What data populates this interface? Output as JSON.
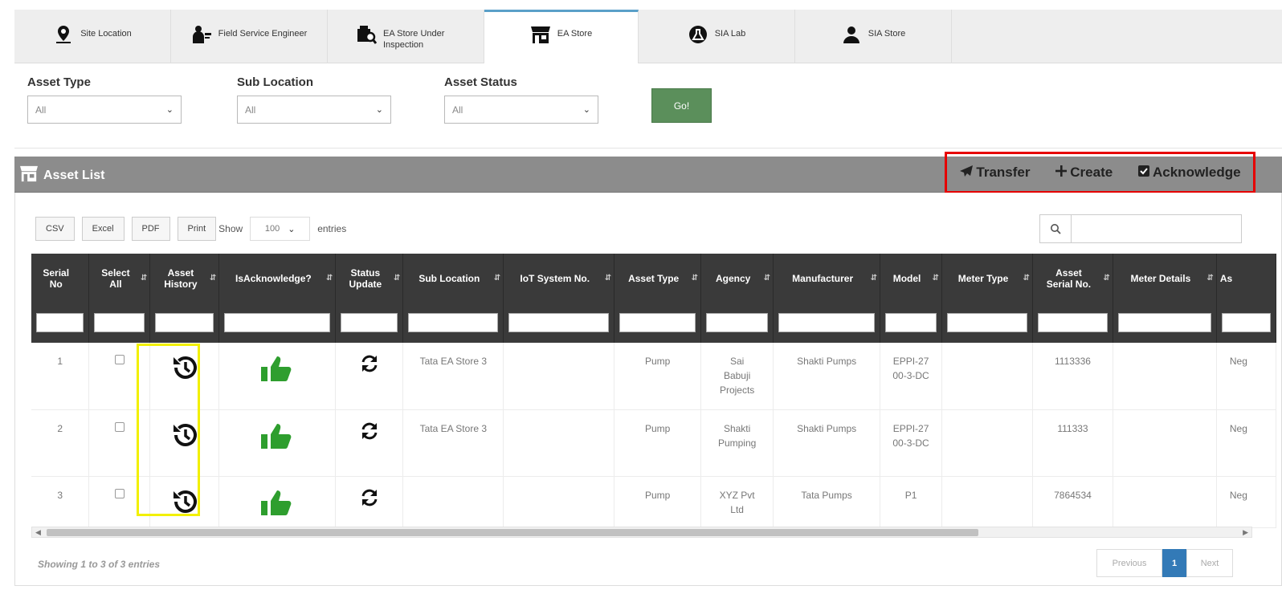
{
  "tabs": [
    {
      "label": "Site Location",
      "icon": "map-pin-person-icon",
      "active": false
    },
    {
      "label": "Field Service Engineer",
      "icon": "engineer-icon",
      "active": false
    },
    {
      "label": "EA Store Under Inspection",
      "icon": "store-inspection-icon",
      "active": false
    },
    {
      "label": "EA Store",
      "icon": "store-icon",
      "active": true
    },
    {
      "label": "SIA Lab",
      "icon": "lab-icon",
      "active": false
    },
    {
      "label": "SIA Store",
      "icon": "person-icon",
      "active": false
    }
  ],
  "filters": {
    "asset_type": {
      "label": "Asset Type",
      "value": "All"
    },
    "sub_location": {
      "label": "Sub Location",
      "value": "All"
    },
    "asset_status": {
      "label": "Asset Status",
      "value": "All"
    },
    "go_label": "Go!"
  },
  "panel": {
    "title": "Asset List",
    "actions": {
      "transfer": "Transfer",
      "create": "Create",
      "acknowledge": "Acknowledge"
    }
  },
  "toolbar": {
    "csv": "CSV",
    "excel": "Excel",
    "pdf": "PDF",
    "print": "Print",
    "show": "Show",
    "entries_value": "100",
    "entries": "entries"
  },
  "table": {
    "columns": [
      {
        "l1": "Serial",
        "l2": "No"
      },
      {
        "l1": "Select",
        "l2": "All"
      },
      {
        "l1": "Asset",
        "l2": "History"
      },
      {
        "l1": "IsAcknowledge?",
        "l2": ""
      },
      {
        "l1": "Status",
        "l2": "Update"
      },
      {
        "l1": "Sub Location",
        "l2": ""
      },
      {
        "l1": "IoT System No.",
        "l2": ""
      },
      {
        "l1": "Asset Type",
        "l2": ""
      },
      {
        "l1": "Agency",
        "l2": ""
      },
      {
        "l1": "Manufacturer",
        "l2": ""
      },
      {
        "l1": "Model",
        "l2": ""
      },
      {
        "l1": "Meter Type",
        "l2": ""
      },
      {
        "l1": "Asset",
        "l2": "Serial No."
      },
      {
        "l1": "Meter Details",
        "l2": ""
      },
      {
        "l1": "As",
        "l2": ""
      }
    ],
    "rows": [
      {
        "serial": "1",
        "sub_location": "Tata EA Store 3",
        "iot": "",
        "asset_type": "Pump",
        "agency": "Sai Babuji Projects",
        "manufacturer": "Shakti Pumps",
        "model": "EPPI-2700-3-DC",
        "meter_type": "",
        "asset_serial": "1113336",
        "meter_details": "",
        "status_trunc": "Neg"
      },
      {
        "serial": "2",
        "sub_location": "Tata EA Store 3",
        "iot": "",
        "asset_type": "Pump",
        "agency": "Shakti Pumping",
        "manufacturer": "Shakti Pumps",
        "model": "EPPI-2700-3-DC",
        "meter_type": "",
        "asset_serial": "111333",
        "meter_details": "",
        "status_trunc": "Neg"
      },
      {
        "serial": "3",
        "sub_location": "",
        "iot": "",
        "asset_type": "Pump",
        "agency": "XYZ Pvt Ltd",
        "manufacturer": "Tata Pumps",
        "model": "P1",
        "meter_type": "",
        "asset_serial": "7864534",
        "meter_details": "",
        "status_trunc": "Neg"
      }
    ]
  },
  "footer": {
    "info": "Showing 1 to 3 of 3 entries",
    "previous": "Previous",
    "current_page": "1",
    "next": "Next"
  },
  "colors": {
    "go_button": "#5b8f5b",
    "header_bar": "#8c8c8c",
    "table_header": "#3a3a3a",
    "highlight_red": "#e60000",
    "highlight_yellow": "#f2f000",
    "thumbs_up": "#2e9e2e",
    "page_active": "#337ab7"
  }
}
